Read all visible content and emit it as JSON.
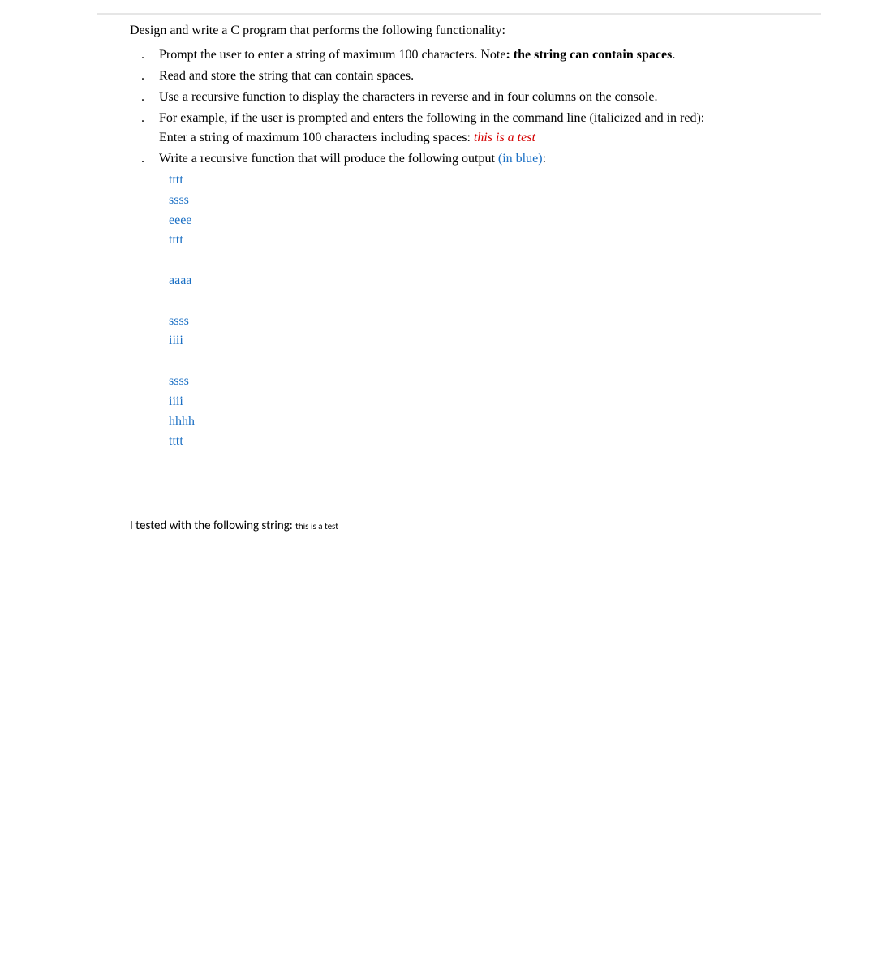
{
  "intro": "Design and write a C program that performs the following functionality:",
  "bullets": {
    "b1_a": "Prompt the user to enter a string of maximum 100 characters. Note",
    "b1_b": ": the string can contain spaces",
    "b1_c": ".",
    "b2": "Read and store the string that can contain spaces.",
    "b3": "Use a recursive function to display the characters in reverse and in four columns on the console.",
    "b4_a": "For example, if the user is prompted and enters the following in the command line (italicized and in red):",
    "b4_b": "Enter a string of maximum 100 characters including spaces: ",
    "b4_c": "this is a test",
    "b5_a": "Write a recursive function that will produce the following output ",
    "b5_b": "(in blue)",
    "b5_c": ":"
  },
  "output_lines": "tttt\nssss\neeee\ntttt\n\naaaa\n\nssss\niiii\n\nssss\niiii\nhhhh\ntttt",
  "tested_label": "I tested with the following string: ",
  "tested_value": "this is a test"
}
